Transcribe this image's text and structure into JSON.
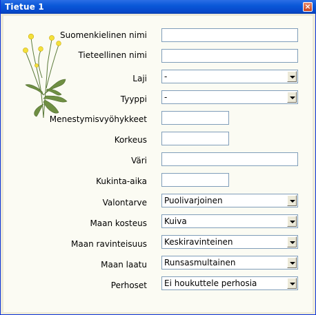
{
  "window": {
    "title": "Tietue 1",
    "close_glyph": "×"
  },
  "plant_icon": "buttercup-illustration",
  "form": {
    "suomenkielinen_nimi": {
      "label": "Suomenkielinen nimi",
      "value": ""
    },
    "tieteellinen_nimi": {
      "label": "Tieteellinen nimi",
      "value": ""
    },
    "laji": {
      "label": "Laji",
      "value": "-"
    },
    "tyyppi": {
      "label": "Tyyppi",
      "value": "-"
    },
    "menestymisvyohykkeet": {
      "label": "Menestymisvyöhykkeet",
      "value": ""
    },
    "korkeus": {
      "label": "Korkeus",
      "value": ""
    },
    "vari": {
      "label": "Väri",
      "value": ""
    },
    "kukinta_aika": {
      "label": "Kukinta-aika",
      "value": ""
    },
    "valontarve": {
      "label": "Valontarve",
      "value": "Puolivarjoinen"
    },
    "maan_kosteus": {
      "label": "Maan kosteus",
      "value": "Kuiva"
    },
    "maan_ravinteisuus": {
      "label": "Maan ravinteisuus",
      "value": "Keskiravinteinen"
    },
    "maan_laatu": {
      "label": "Maan laatu",
      "value": "Runsasmultainen"
    },
    "perhoset": {
      "label": "Perhoset",
      "value": "Ei houkuttele perhosia"
    }
  }
}
